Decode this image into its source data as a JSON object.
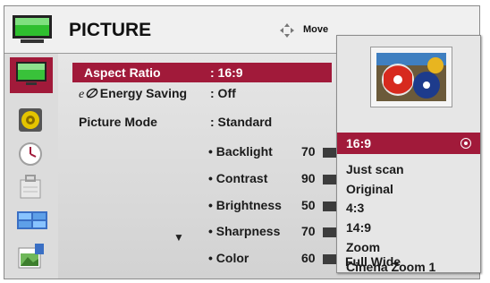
{
  "header": {
    "title": "PICTURE",
    "move_label": "Move"
  },
  "sidebar": {
    "items": [
      {
        "name": "picture-icon",
        "active": true
      },
      {
        "name": "speaker-icon"
      },
      {
        "name": "clock-icon"
      },
      {
        "name": "lock-icon"
      },
      {
        "name": "option-icon"
      },
      {
        "name": "usb-icon"
      }
    ]
  },
  "menu": {
    "rows": [
      {
        "label": "Aspect Ratio",
        "value": ": 16:9",
        "selected": true
      },
      {
        "label": " Energy Saving",
        "value": ": Off"
      },
      {
        "label": "Picture Mode",
        "value": ": Standard"
      }
    ],
    "sliders": [
      {
        "label": "• Backlight",
        "value": "70"
      },
      {
        "label": "• Contrast",
        "value": "90"
      },
      {
        "label": "• Brightness",
        "value": "50"
      },
      {
        "label": "• Sharpness",
        "value": "70"
      },
      {
        "label": "• Color",
        "value": "60"
      }
    ],
    "more_arrow": "▼"
  },
  "aspect_popup": {
    "options": [
      "16:9",
      "Just scan",
      "Original",
      "4:3",
      "14:9",
      "Zoom",
      "Cinena Zoom 1",
      "Full Wide"
    ],
    "selected": "16:9"
  },
  "colors": {
    "accent": "#a11a3a",
    "panel": "#d9d9d9"
  }
}
